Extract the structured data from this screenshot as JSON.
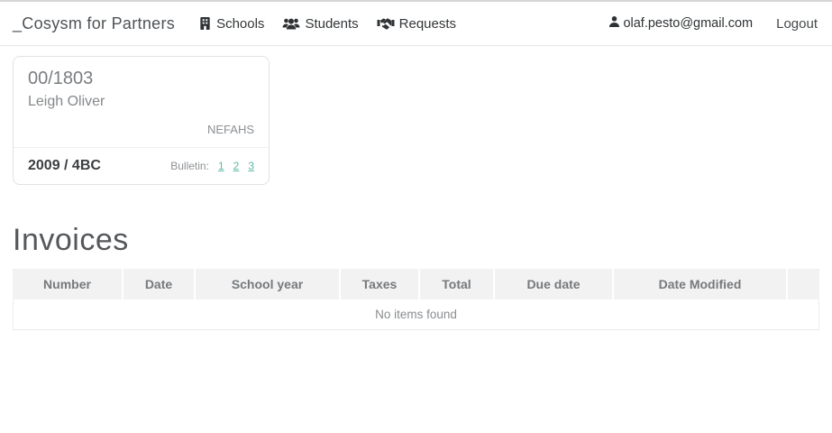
{
  "navbar": {
    "brand": "_Cosysm for Partners",
    "items": [
      {
        "label": "Schools",
        "icon": "school-icon"
      },
      {
        "label": "Students",
        "icon": "students-icon"
      },
      {
        "label": "Requests",
        "icon": "handshake-icon"
      }
    ],
    "user_email": "olaf.pesto@gmail.com",
    "logout_label": "Logout"
  },
  "student_card": {
    "number": "00/1803",
    "name": "Leigh Oliver",
    "school_code": "NEFAHS",
    "year_class": "2009 / 4BC",
    "bulletin_label": "Bulletin:",
    "bulletin_links": [
      "1",
      "2",
      "3"
    ]
  },
  "invoices": {
    "title": "Invoices",
    "columns": [
      "Number",
      "Date",
      "School year",
      "Taxes",
      "Total",
      "Due date",
      "Date Modified",
      ""
    ],
    "empty_message": "No items found"
  },
  "colors": {
    "accent_teal": "#5bb9a4",
    "table_header_bg": "#f2f2f2",
    "nav_text": "#333639",
    "muted_text": "#85888b"
  }
}
